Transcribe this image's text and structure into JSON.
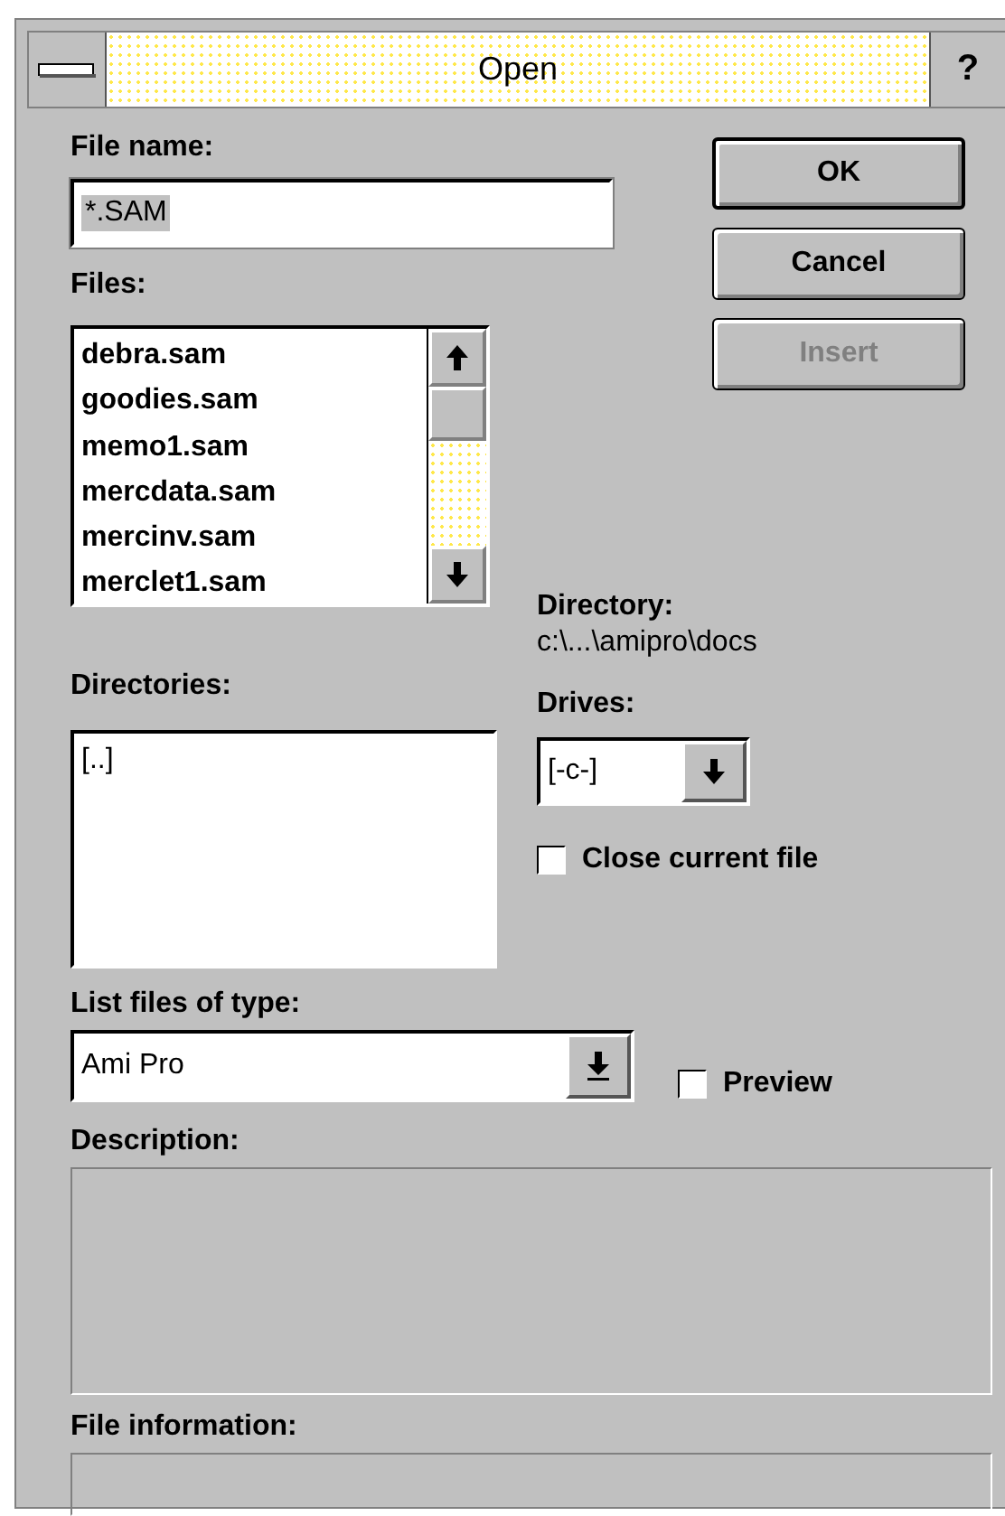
{
  "window": {
    "title": "Open",
    "help_button": "?"
  },
  "file_name": {
    "label": "File name:",
    "value": "*.SAM",
    "selected": true
  },
  "buttons": [
    {
      "label": "OK",
      "default": true,
      "disabled": false
    },
    {
      "label": "Cancel",
      "default": false,
      "disabled": false
    },
    {
      "label": "Insert",
      "default": false,
      "disabled": true
    }
  ],
  "files": {
    "label": "Files:",
    "items": [
      {
        "label": "debra.sam",
        "selected": false
      },
      {
        "label": "goodies.sam",
        "selected": false
      },
      {
        "label": "memo1.sam",
        "selected": false
      },
      {
        "label": "mercdata.sam",
        "selected": false
      },
      {
        "label": "mercinv.sam",
        "selected": false
      },
      {
        "label": "merclet1.sam",
        "selected": false
      }
    ]
  },
  "directory": {
    "label": "Directory:",
    "path": "c:\\...\\amipro\\docs"
  },
  "directories": {
    "label": "Directories:",
    "items": [
      {
        "label": "[..]",
        "selected": false
      }
    ]
  },
  "drives": {
    "label": "Drives:",
    "value": "[-c-]"
  },
  "close_current_file": {
    "label": "Close current file",
    "checked": false
  },
  "file_type": {
    "label": "List files of type:",
    "value": "Ami Pro"
  },
  "preview": {
    "label": "Preview",
    "checked": false
  },
  "description": {
    "label": "Description:"
  },
  "file_information": {
    "label": "File information:"
  }
}
